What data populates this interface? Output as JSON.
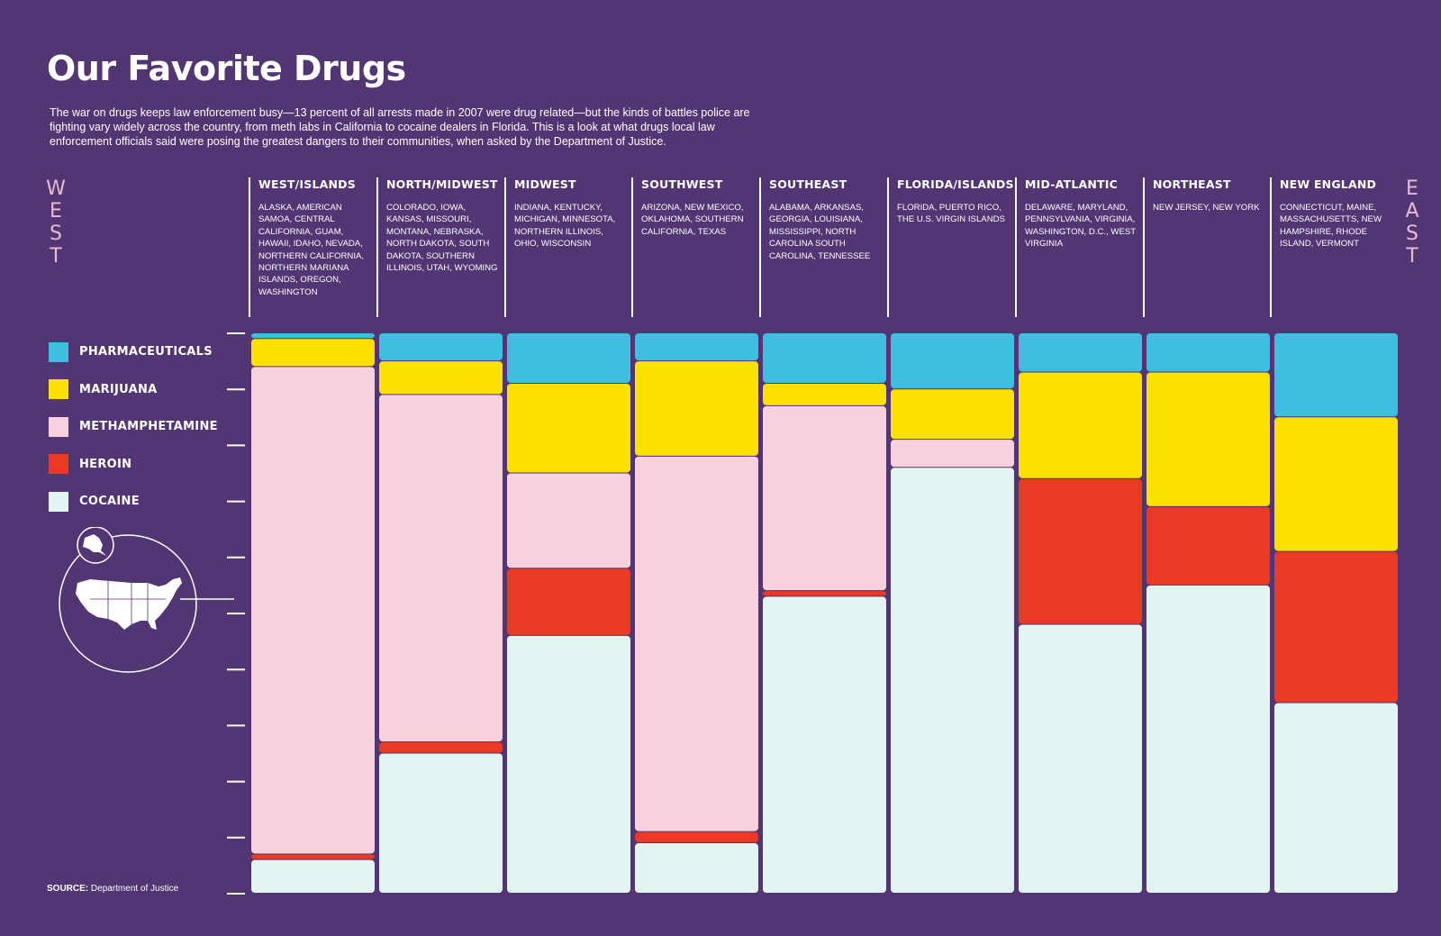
{
  "header": {
    "title": "Our Favorite Drugs",
    "intro": "The war on drugs keeps law enforcement busy—13 percent of all arrests made in 2007 were drug related—but the kinds of battles police are fighting vary widely across the country, from meth labs in California to cocaine dealers in Florida. This is a look at what drugs local law enforcement officials said were posing the greatest dangers to their communities, when asked by the Department of Justice."
  },
  "compass": {
    "west": "W\nE\nS\nT",
    "east": "E\nA\nS\nT"
  },
  "regions": [
    {
      "name": "WEST/ISLANDS",
      "states": "ALASKA, AMERICAN SAMOA, CENTRAL CALIFORNIA, GUAM, HAWAII, IDAHO, NEVADA, NORTHERN CALIFORNIA, NORTHERN MARIANA ISLANDS, OREGON, WASHINGTON"
    },
    {
      "name": "NORTH/MIDWEST",
      "states": "COLORADO, IOWA, KANSAS, MISSOURI, MONTANA, NEBRASKA, NORTH DAKOTA, SOUTH DAKOTA, SOUTHERN ILLINOIS, UTAH, WYOMING"
    },
    {
      "name": "MIDWEST",
      "states": "INDIANA, KENTUCKY, MICHIGAN, MINNESOTA, NORTHERN ILLINOIS, OHIO, WISCONSIN"
    },
    {
      "name": "SOUTHWEST",
      "states": "ARIZONA, NEW MEXICO, OKLAHOMA, SOUTHERN CALIFORNIA, TEXAS"
    },
    {
      "name": "SOUTHEAST",
      "states": "ALABAMA, ARKANSAS, GEORGIA, LOUISIANA, MISSISSIPPI, NORTH CAROLINA SOUTH CAROLINA, TENNESSEE"
    },
    {
      "name": "FLORIDA/ISLANDS",
      "states": "FLORIDA, PUERTO RICO, THE U.S. VIRGIN ISLANDS"
    },
    {
      "name": "MID-ATLANTIC",
      "states": "DELAWARE, MARYLAND, PENNSYLVANIA, VIRGINIA, WASHINGTON, D.C., WEST VIRGINIA"
    },
    {
      "name": "NORTHEAST",
      "states": "NEW JERSEY, NEW YORK"
    },
    {
      "name": "NEW ENGLAND",
      "states": "CONNECTICUT, MAINE, MASSACHUSETTS, NEW HAMPSHIRE, RHODE ISLAND, VERMONT"
    }
  ],
  "legend": [
    {
      "label": "PHARMACEUTICALS",
      "color": "#3cbfe0"
    },
    {
      "label": "MARIJUANA",
      "color": "#fbe001"
    },
    {
      "label": "METHAMPHETAMINE",
      "color": "#f7d1dc"
    },
    {
      "label": "HEROIN",
      "color": "#ea3a25"
    },
    {
      "label": "COCAINE",
      "color": "#e4f4f2"
    }
  ],
  "source": {
    "label": "SOURCE:",
    "text": "Department of Justice"
  },
  "chart_data": {
    "type": "bar",
    "stacked": true,
    "percent_stacked": true,
    "categories": [
      "WEST/ISLANDS",
      "NORTH/MIDWEST",
      "MIDWEST",
      "SOUTHWEST",
      "SOUTHEAST",
      "FLORIDA/ISLANDS",
      "MID-ATLANTIC",
      "NORTHEAST",
      "NEW ENGLAND"
    ],
    "series": [
      {
        "name": "PHARMACEUTICALS",
        "color": "#3cbfe0",
        "values": [
          1,
          5,
          9,
          5,
          9,
          10,
          7,
          7,
          15
        ]
      },
      {
        "name": "MARIJUANA",
        "color": "#fbe001",
        "values": [
          5,
          6,
          16,
          17,
          4,
          9,
          19,
          24,
          24
        ]
      },
      {
        "name": "METHAMPHETAMINE",
        "color": "#f7d1dc",
        "values": [
          87,
          62,
          17,
          67,
          33,
          5,
          0,
          0,
          0
        ]
      },
      {
        "name": "HEROIN",
        "color": "#ea3a25",
        "values": [
          1,
          2,
          12,
          2,
          1,
          0,
          26,
          14,
          27
        ]
      },
      {
        "name": "COCAINE",
        "color": "#e4f4f2",
        "values": [
          6,
          25,
          46,
          9,
          53,
          76,
          48,
          55,
          34
        ]
      }
    ],
    "ylim": [
      0,
      100
    ],
    "grid": false,
    "legend_position": "left"
  }
}
